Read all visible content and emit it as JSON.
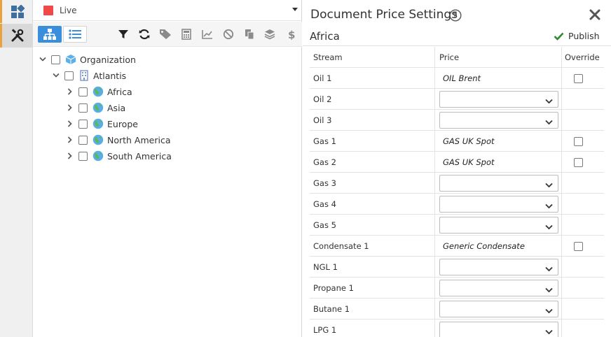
{
  "header": {
    "status_label": "Live"
  },
  "tree": {
    "nodes": [
      {
        "label": "Organization",
        "icon": "cube-icon",
        "level": 0,
        "expanded": true
      },
      {
        "label": "Atlantis",
        "icon": "building-icon",
        "level": 1,
        "expanded": true
      },
      {
        "label": "Africa",
        "icon": "globe-icon",
        "level": 2,
        "expanded": false
      },
      {
        "label": "Asia",
        "icon": "globe-icon",
        "level": 2,
        "expanded": false
      },
      {
        "label": "Europe",
        "icon": "globe-icon",
        "level": 2,
        "expanded": false
      },
      {
        "label": "North America",
        "icon": "globe-icon",
        "level": 2,
        "expanded": false
      },
      {
        "label": "South America",
        "icon": "globe-icon",
        "level": 2,
        "expanded": false
      }
    ]
  },
  "panel": {
    "title": "Document Price Settings",
    "region": "Africa",
    "publish_label": "Publish",
    "columns": {
      "stream": "Stream",
      "price": "Price",
      "override": "Override"
    },
    "rows": [
      {
        "stream": "Oil 1",
        "price": "OIL Brent",
        "type": "text"
      },
      {
        "stream": "Oil 2",
        "price": "",
        "type": "select"
      },
      {
        "stream": "Oil 3",
        "price": "",
        "type": "select"
      },
      {
        "stream": "Gas 1",
        "price": "GAS UK Spot",
        "type": "text"
      },
      {
        "stream": "Gas 2",
        "price": "GAS UK Spot",
        "type": "text"
      },
      {
        "stream": "Gas 3",
        "price": "",
        "type": "select"
      },
      {
        "stream": "Gas 4",
        "price": "",
        "type": "select"
      },
      {
        "stream": "Gas 5",
        "price": "",
        "type": "select"
      },
      {
        "stream": "Condensate 1",
        "price": "Generic Condensate",
        "type": "text"
      },
      {
        "stream": "NGL 1",
        "price": "",
        "type": "select"
      },
      {
        "stream": "Propane 1",
        "price": "",
        "type": "select"
      },
      {
        "stream": "Butane 1",
        "price": "",
        "type": "select"
      },
      {
        "stream": "LPG 1",
        "price": "",
        "type": "select"
      }
    ]
  },
  "colors": {
    "accent": "#3a8fdc",
    "live": "#ef4a4a",
    "publish_check": "#2e8b2e",
    "rail_marker": "#e8a33d"
  }
}
